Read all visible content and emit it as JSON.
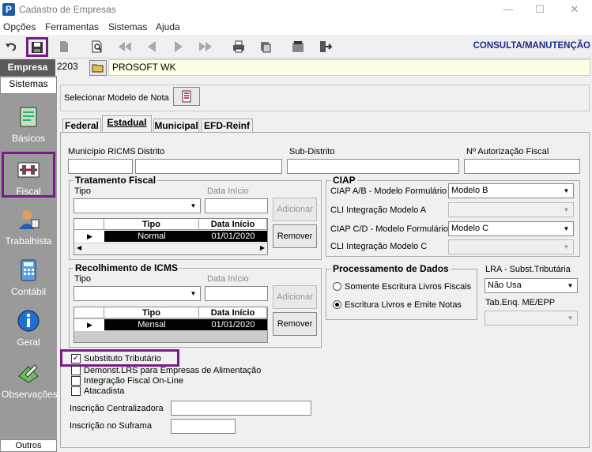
{
  "window": {
    "title": "Cadastro de Empresas",
    "app_icon": "P"
  },
  "menu": [
    "Opções",
    "Ferramentas",
    "Sistemas",
    "Ajuda"
  ],
  "mode": "CONSULTA/MANUTENÇÃO",
  "empresa": {
    "label": "Empresa",
    "code": "2203",
    "name": "PROSOFT WK"
  },
  "sidebar": {
    "top": "Sistemas",
    "items": [
      "Básicos",
      "Fiscal",
      "Trabalhista",
      "Contábil",
      "Geral",
      "Observações"
    ],
    "bottom": "Outros"
  },
  "selecionar": "Selecionar Modelo de Nota",
  "tabs": [
    "Federal",
    "Estadual",
    "Municipal",
    "EFD-Reinf"
  ],
  "fields": {
    "municipio": "Município RICMS",
    "distrito": "Distrito",
    "subdistrito": "Sub-Distrito",
    "autorizacao": "Nº Autorização Fiscal"
  },
  "tratamento": {
    "title": "Tratamento Fiscal",
    "tipo": "Tipo",
    "data": "Data Início",
    "add": "Adicionar",
    "remove": "Remover",
    "col_tipo": "Tipo",
    "col_data": "Data Início",
    "row_tipo": "Normal",
    "row_data": "01/01/2020"
  },
  "recolhimento": {
    "title": "Recolhimento de ICMS",
    "tipo": "Tipo",
    "data": "Data Início",
    "add": "Adicionar",
    "remove": "Remover",
    "col_tipo": "Tipo",
    "col_data": "Data Início",
    "row_tipo": "Mensal",
    "row_data": "01/01/2020"
  },
  "ciap": {
    "title": "CIAP",
    "l1": "CIAP  A/B - Modelo Formulário",
    "v1": "Modelo B",
    "l2": "CLI Integração Modelo A",
    "l3": "CIAP C/D - Modelo Formulário",
    "v3": "Modelo C",
    "l4": "CLI Integração Modelo C"
  },
  "processamento": {
    "title": "Processamento de Dados",
    "r1": "Somente Escritura Livros Fiscais",
    "r2": "Escritura Livros e Emite Notas"
  },
  "lra": {
    "label": "LRA - Subst.Tributária",
    "value": "Não Usa",
    "tab_label": "Tab.Enq. ME/EPP"
  },
  "checks": {
    "c1": "Substituto Tributário",
    "c2": "Demonst.LRS para Empresas de Alimentação",
    "c3": "Integração Fiscal On-Line",
    "c4": "Atacadista"
  },
  "inscricao": {
    "centralizadora": "Inscrição Centralizadora",
    "suframa": "Inscrição no Suframa"
  }
}
